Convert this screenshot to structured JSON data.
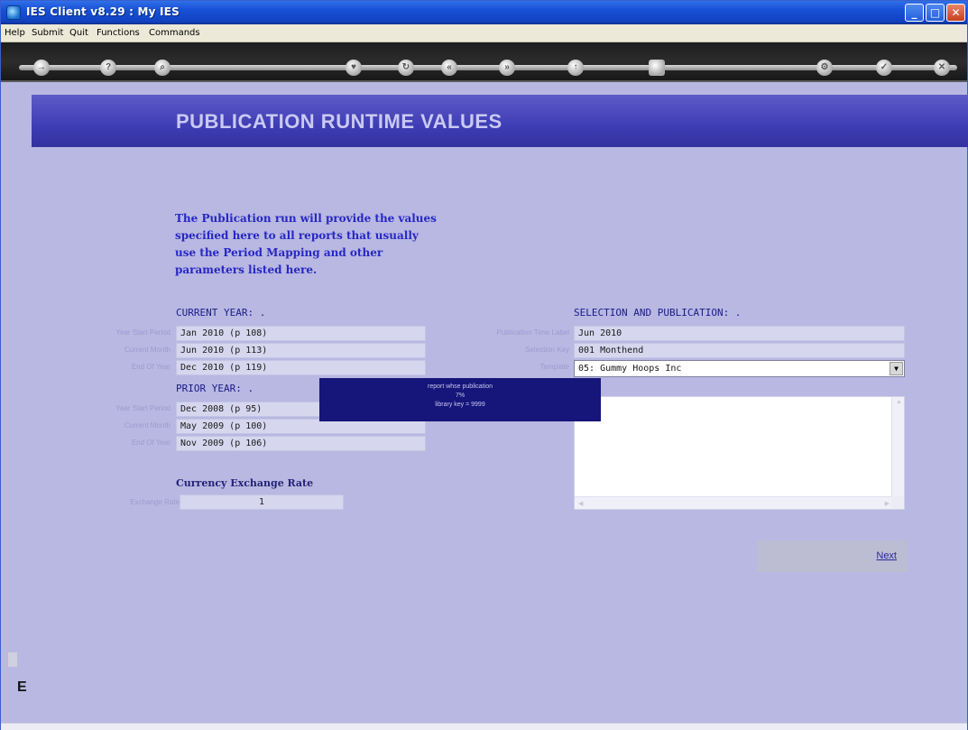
{
  "window": {
    "title": "IES Client v8.29 : My IES",
    "min": "_",
    "max": "□",
    "close": "✕"
  },
  "menu": [
    "Help",
    "Submit",
    "Quit",
    "Functions",
    "Commands"
  ],
  "toolbar": {
    "icons": [
      "arrow-icon",
      "help-icon",
      "search-icon",
      "heart-icon",
      "refresh-icon",
      "rewind-icon",
      "forward-icon",
      "up-icon",
      "stop-icon",
      "settings-icon",
      "check-icon",
      "close-icon"
    ]
  },
  "banner": {
    "title": "PUBLICATION RUNTIME VALUES"
  },
  "intro": "The Publication run will provide the values specified here to all reports that usually use the Period Mapping and other parameters listed here.",
  "current_year": {
    "heading": "CURRENT YEAR: .",
    "fields": [
      {
        "label": "Year Start Period",
        "value": "Jan 2010 (p 108)"
      },
      {
        "label": "Current Month",
        "value": "Jun 2010 (p 113)"
      },
      {
        "label": "End Of Year",
        "value": "Dec 2010 (p 119)"
      }
    ]
  },
  "prior_year": {
    "heading": "PRIOR YEAR: .",
    "fields": [
      {
        "label": "Year Start Period",
        "value": "Dec 2008 (p 95)"
      },
      {
        "label": "Current Month",
        "value": "May 2009 (p 100)"
      },
      {
        "label": "End Of Year",
        "value": "Nov 2009 (p 106)"
      }
    ]
  },
  "currency": {
    "heading": "Currency Exchange Rate",
    "label": "Exchange Rate",
    "value": "1"
  },
  "selection": {
    "heading": "SELECTION AND PUBLICATION: .",
    "fields": [
      {
        "label": "Publication Time Label",
        "value": "Jun 2010"
      },
      {
        "label": "Selection Key",
        "value": "001 Monthend"
      }
    ],
    "template_label": "Template",
    "template_value": "05: Gummy Hoops Inc"
  },
  "progress": {
    "line1": "report whse publication",
    "line2": "7%",
    "line3": "library key = 9999",
    "percent": 7
  },
  "next": {
    "label": "Next"
  },
  "side": {
    "e": "E"
  }
}
